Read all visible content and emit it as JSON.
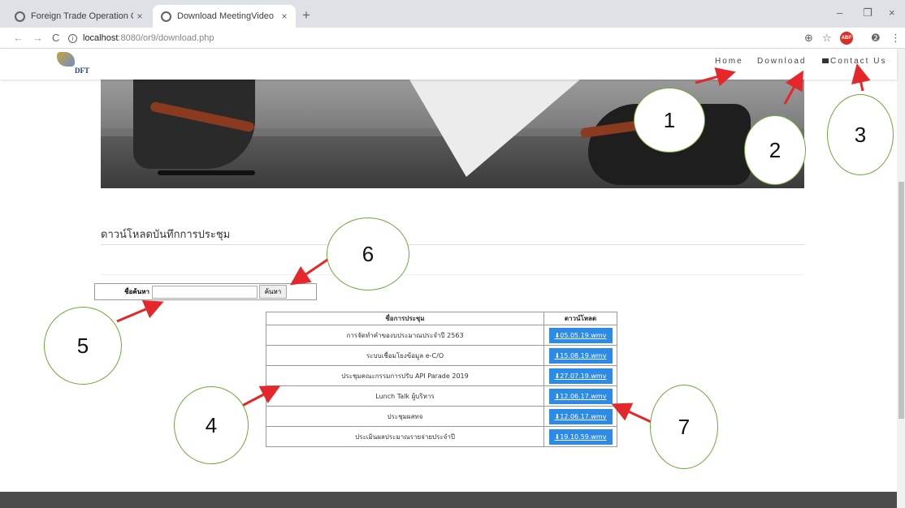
{
  "browser": {
    "tabs": [
      {
        "title": "Foreign Trade Operation Center",
        "close": "×"
      },
      {
        "title": "Download MeetingVideo",
        "close": "×"
      }
    ],
    "new_tab": "+",
    "window_controls": {
      "minimize": "–",
      "restore": "❐",
      "close": "×"
    },
    "nav": {
      "back": "←",
      "forward": "→",
      "reload": "C"
    },
    "url_host": "localhost",
    "url_path": ":8080/or9/download.php",
    "toolbar_icons": {
      "zoom": "⊕",
      "bookmark": "☆",
      "profile": "❷",
      "menu": "⋮",
      "adblock": "ABP"
    }
  },
  "site": {
    "logo_text": "DFT",
    "nav": {
      "home": "Home",
      "download": "Download",
      "contact": "Contact Us"
    }
  },
  "page": {
    "title": "ดาวน์โหลดบันทึกการประชุม",
    "search": {
      "label": "ชื่อค้นหา",
      "value": "",
      "button": "ค้นหา"
    },
    "table": {
      "headers": [
        "ชื่อการประชุม",
        "ดาวน์โหลด"
      ],
      "rows": [
        {
          "name": "การจัดทำคำของบประมาณประจำปี 2563",
          "file": "05.05.19.wmv"
        },
        {
          "name": "ระบบเชื่อมโยงข้อมูล e-C/O",
          "file": "15.08.19.wmv"
        },
        {
          "name": "ประชุมคณะกรรมการปรับ API Parade 2019",
          "file": "27.07.19.wmv"
        },
        {
          "name": "Lunch Talk ผู้บริหาร",
          "file": "12.06.17.wmv"
        },
        {
          "name": "ประชุมผสทจ",
          "file": "12.06.17.wmv"
        },
        {
          "name": "ประเมินผลประมาณรายจ่ายประจำปี",
          "file": "19.10.59.wmv"
        }
      ]
    }
  },
  "annotations": [
    "1",
    "2",
    "3",
    "4",
    "5",
    "6",
    "7"
  ],
  "colors": {
    "callout_border": "#6ea83a",
    "arrow": "#e5262b",
    "download_button": "#2d8be8"
  }
}
